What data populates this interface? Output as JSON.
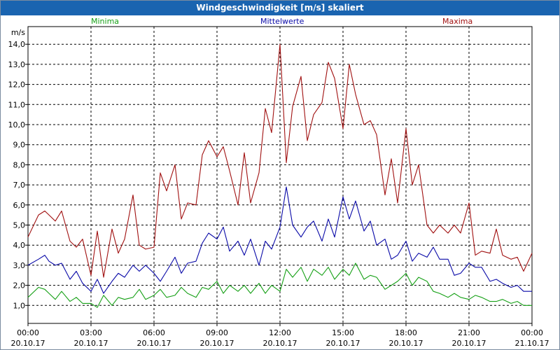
{
  "title": "Windgeschwindigkeit [m/s] skaliert",
  "colors": {
    "minima": "#16a016",
    "mittel": "#0a0aa8",
    "maxima": "#a01010",
    "titlebar": "#1a64b0"
  },
  "chart_data": {
    "type": "line",
    "title": "Windgeschwindigkeit [m/s] skaliert",
    "ylabel": "m/s",
    "ylim": [
      0,
      14.5
    ],
    "xlim": [
      0,
      24
    ],
    "grid": true,
    "legend_placement": "top",
    "yticks": [
      "1,0",
      "2,0",
      "3,0",
      "4,0",
      "5,0",
      "6,0",
      "7,0",
      "8,0",
      "9,0",
      "10,0",
      "11,0",
      "12,0",
      "13,0",
      "14,0"
    ],
    "ytick_values": [
      1,
      2,
      3,
      4,
      5,
      6,
      7,
      8,
      9,
      10,
      11,
      12,
      13,
      14
    ],
    "xticks": [
      {
        "time": "00:00",
        "date": "20.10.17"
      },
      {
        "time": "03:00",
        "date": "20.10.17"
      },
      {
        "time": "06:00",
        "date": "20.10.17"
      },
      {
        "time": "09:00",
        "date": "20.10.17"
      },
      {
        "time": "12:00",
        "date": "20.10.17"
      },
      {
        "time": "15:00",
        "date": "20.10.17"
      },
      {
        "time": "18:00",
        "date": "20.10.17"
      },
      {
        "time": "21:00",
        "date": "20.10.17"
      },
      {
        "time": "00:00",
        "date": "21.10.17"
      }
    ],
    "series": [
      {
        "name": "Minima",
        "x_hours": [
          0,
          0.5,
          0.8,
          1,
          1.3,
          1.6,
          2,
          2.3,
          2.6,
          3,
          3.3,
          3.6,
          4,
          4.3,
          4.6,
          5,
          5.3,
          5.6,
          6,
          6.3,
          6.6,
          7,
          7.3,
          7.6,
          8,
          8.3,
          8.6,
          9,
          9.3,
          9.6,
          10,
          10.3,
          10.6,
          11,
          11.3,
          11.6,
          12,
          12.3,
          12.6,
          13,
          13.3,
          13.6,
          14,
          14.3,
          14.6,
          15,
          15.3,
          15.6,
          16,
          16.3,
          16.6,
          17,
          17.3,
          17.6,
          18,
          18.3,
          18.6,
          19,
          19.3,
          19.6,
          20,
          20.3,
          20.6,
          21,
          21.3,
          21.6,
          22,
          22.3,
          22.6,
          23,
          23.3,
          23.6,
          24
        ],
        "values": [
          1.4,
          1.9,
          1.8,
          1.6,
          1.3,
          1.7,
          1.2,
          1.4,
          1.1,
          1.1,
          0.9,
          1.5,
          1.0,
          1.4,
          1.3,
          1.4,
          1.8,
          1.3,
          1.5,
          1.8,
          1.4,
          1.5,
          1.9,
          1.6,
          1.4,
          1.9,
          1.8,
          2.2,
          1.6,
          2.0,
          1.7,
          2.0,
          1.6,
          2.1,
          1.6,
          2.0,
          1.7,
          2.8,
          2.4,
          2.9,
          2.2,
          2.8,
          2.5,
          2.9,
          2.3,
          2.8,
          2.5,
          3.1,
          2.3,
          2.5,
          2.4,
          1.8,
          2.0,
          2.2,
          2.6,
          2.0,
          2.4,
          2.2,
          1.7,
          1.6,
          1.4,
          1.6,
          1.4,
          1.3,
          1.5,
          1.4,
          1.2,
          1.2,
          1.3,
          1.1,
          1.2,
          1.0,
          1.0
        ]
      },
      {
        "name": "Mittelwerte",
        "x_hours": [
          0,
          0.5,
          0.8,
          1,
          1.3,
          1.6,
          2,
          2.3,
          2.6,
          3,
          3.3,
          3.6,
          4,
          4.3,
          4.6,
          5,
          5.3,
          5.6,
          6,
          6.3,
          6.6,
          7,
          7.3,
          7.6,
          8,
          8.3,
          8.6,
          9,
          9.3,
          9.6,
          10,
          10.3,
          10.6,
          11,
          11.3,
          11.6,
          12,
          12.3,
          12.6,
          13,
          13.3,
          13.6,
          14,
          14.3,
          14.6,
          15,
          15.3,
          15.6,
          16,
          16.3,
          16.6,
          17,
          17.3,
          17.6,
          18,
          18.3,
          18.6,
          19,
          19.3,
          19.6,
          20,
          20.3,
          20.6,
          21,
          21.3,
          21.6,
          22,
          22.3,
          22.6,
          23,
          23.3,
          23.6,
          24
        ],
        "values": [
          3.0,
          3.3,
          3.5,
          3.2,
          3.0,
          3.1,
          2.3,
          2.7,
          2.1,
          1.7,
          2.3,
          1.6,
          2.2,
          2.6,
          2.4,
          3.0,
          2.7,
          3.0,
          2.6,
          2.2,
          2.7,
          3.4,
          2.6,
          3.1,
          3.2,
          4.1,
          4.6,
          4.3,
          4.9,
          3.7,
          4.2,
          3.5,
          4.3,
          3.0,
          4.2,
          3.8,
          4.9,
          6.9,
          5.0,
          4.4,
          4.9,
          5.2,
          4.2,
          5.3,
          4.4,
          6.4,
          5.3,
          6.2,
          4.7,
          5.2,
          4.0,
          4.3,
          3.3,
          3.5,
          4.2,
          3.2,
          3.6,
          3.4,
          3.9,
          3.3,
          3.3,
          2.5,
          2.6,
          3.1,
          2.9,
          2.9,
          2.2,
          2.3,
          2.1,
          1.9,
          2.0,
          1.7,
          1.7
        ]
      },
      {
        "name": "Maxima",
        "x_hours": [
          0,
          0.5,
          0.8,
          1,
          1.3,
          1.6,
          2,
          2.3,
          2.6,
          3,
          3.3,
          3.6,
          4,
          4.3,
          4.6,
          5,
          5.3,
          5.6,
          6,
          6.3,
          6.6,
          7,
          7.3,
          7.6,
          8,
          8.3,
          8.6,
          9,
          9.3,
          9.6,
          10,
          10.3,
          10.6,
          11,
          11.3,
          11.6,
          12,
          12.3,
          12.6,
          13,
          13.3,
          13.6,
          14,
          14.3,
          14.6,
          15,
          15.3,
          15.6,
          16,
          16.3,
          16.6,
          17,
          17.3,
          17.6,
          18,
          18.3,
          18.6,
          19,
          19.3,
          19.6,
          20,
          20.3,
          20.6,
          21,
          21.3,
          21.6,
          22,
          22.3,
          22.6,
          23,
          23.3,
          23.6,
          24
        ],
        "values": [
          4.4,
          5.5,
          5.7,
          5.5,
          5.2,
          5.7,
          4.2,
          3.9,
          4.3,
          2.5,
          4.7,
          2.4,
          4.8,
          3.6,
          4.3,
          6.5,
          4.0,
          3.8,
          3.9,
          7.6,
          6.7,
          8.0,
          5.3,
          6.1,
          6.0,
          8.5,
          9.2,
          8.4,
          8.9,
          7.7,
          6.0,
          8.6,
          6.1,
          7.6,
          10.8,
          9.6,
          14.0,
          8.1,
          10.9,
          12.4,
          9.2,
          10.5,
          11.1,
          13.1,
          12.3,
          9.8,
          13.0,
          11.5,
          10.0,
          10.2,
          9.5,
          6.5,
          8.3,
          6.1,
          9.8,
          7.0,
          8.0,
          5.0,
          4.6,
          5.0,
          4.6,
          5.0,
          4.6,
          6.1,
          3.5,
          3.7,
          3.6,
          4.8,
          3.5,
          3.3,
          3.4,
          2.7,
          3.6
        ]
      }
    ]
  }
}
